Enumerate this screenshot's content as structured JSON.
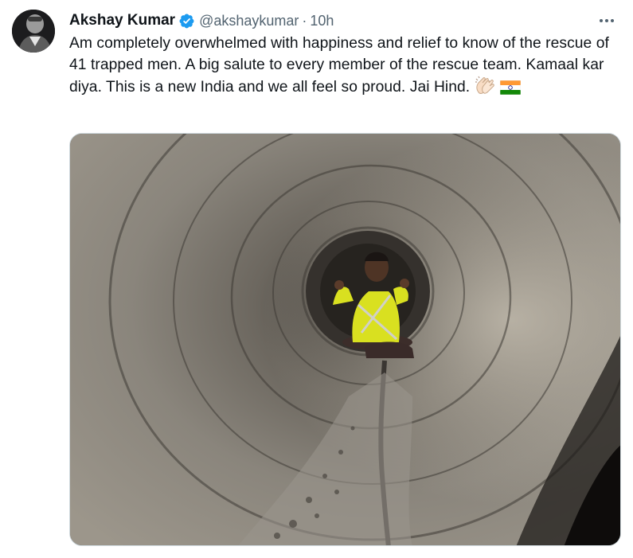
{
  "tweet": {
    "author_name": "Akshay Kumar",
    "handle": "@akshaykumar",
    "separator": "·",
    "timestamp": "10h",
    "text": "Am completely overwhelmed with happiness and relief to know of the rescue of 41 trapped men. A big salute to every member of the rescue team. Kamaal kar diya. This is a new India and we all feel so proud. Jai Hind.",
    "emojis": [
      "clapping-hands-icon",
      "india-flag-icon"
    ],
    "verified": true
  },
  "colors": {
    "text_primary": "#0f1419",
    "text_secondary": "#536471",
    "verified_blue": "#1d9bf0",
    "border": "#cfd9de"
  }
}
